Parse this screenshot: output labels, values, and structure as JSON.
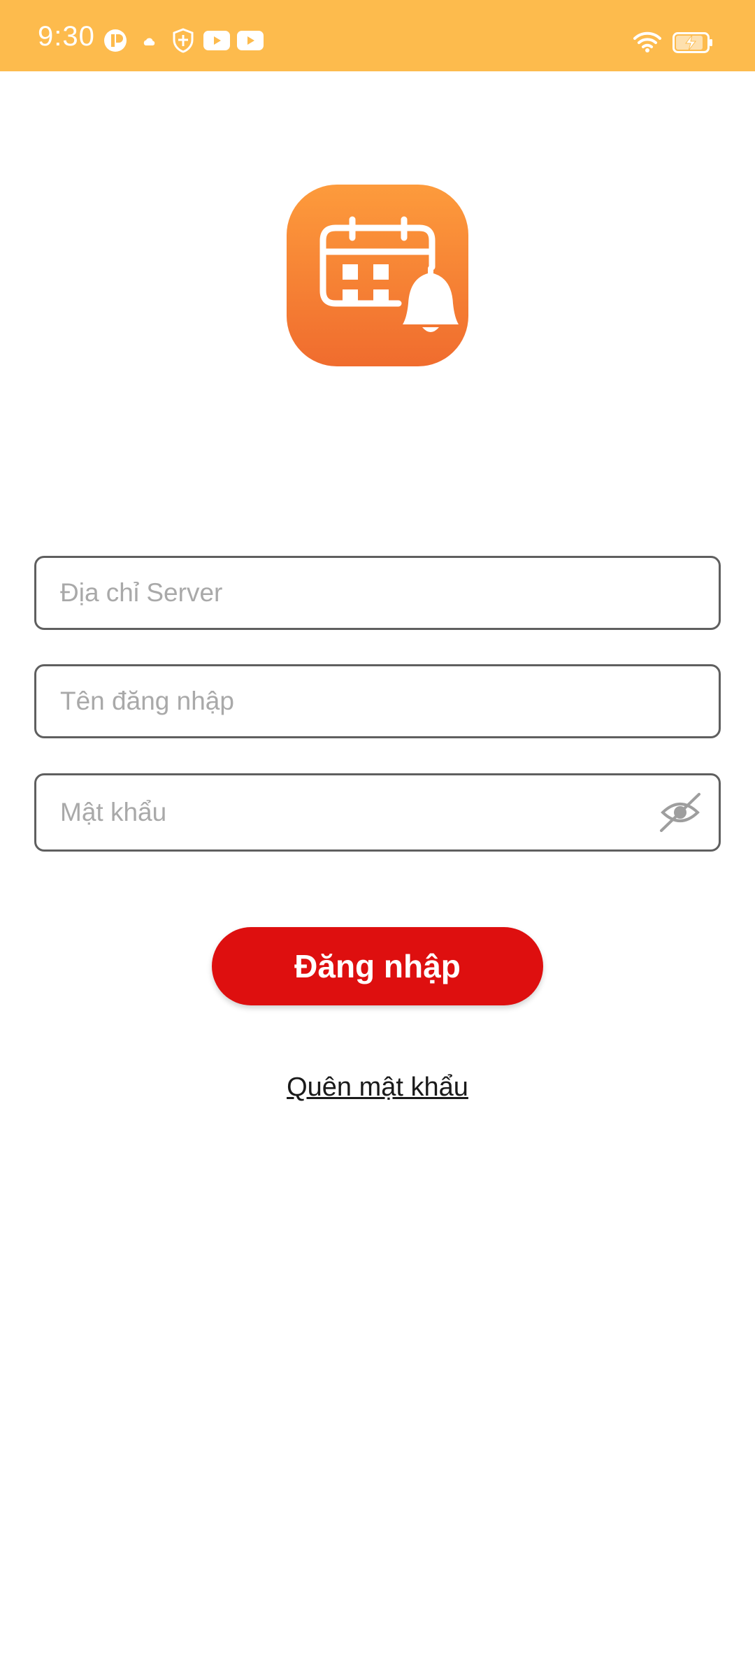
{
  "status_bar": {
    "time": "9:30",
    "background_color": "#FDBB4D",
    "left_icons": [
      "app-indicator-icon",
      "cloud-icon",
      "shield-icon",
      "youtube-icon",
      "youtube-icon"
    ],
    "right_icons": [
      "wifi-icon",
      "battery-charging-icon"
    ]
  },
  "logo": {
    "icon": "calendar-bell-icon",
    "gradient_top": "#FD9B3C",
    "gradient_bottom": "#F06C2E"
  },
  "form": {
    "server_placeholder": "Địa chỉ Server",
    "server_value": "",
    "username_placeholder": "Tên đăng nhập",
    "username_value": "",
    "password_placeholder": "Mật khẩu",
    "password_value": "",
    "password_toggle_icon": "eye-off-icon"
  },
  "login_button": {
    "label": "Đăng nhập",
    "color": "#DE0F0F"
  },
  "forgot_password": {
    "label": "Quên mật khẩu"
  }
}
